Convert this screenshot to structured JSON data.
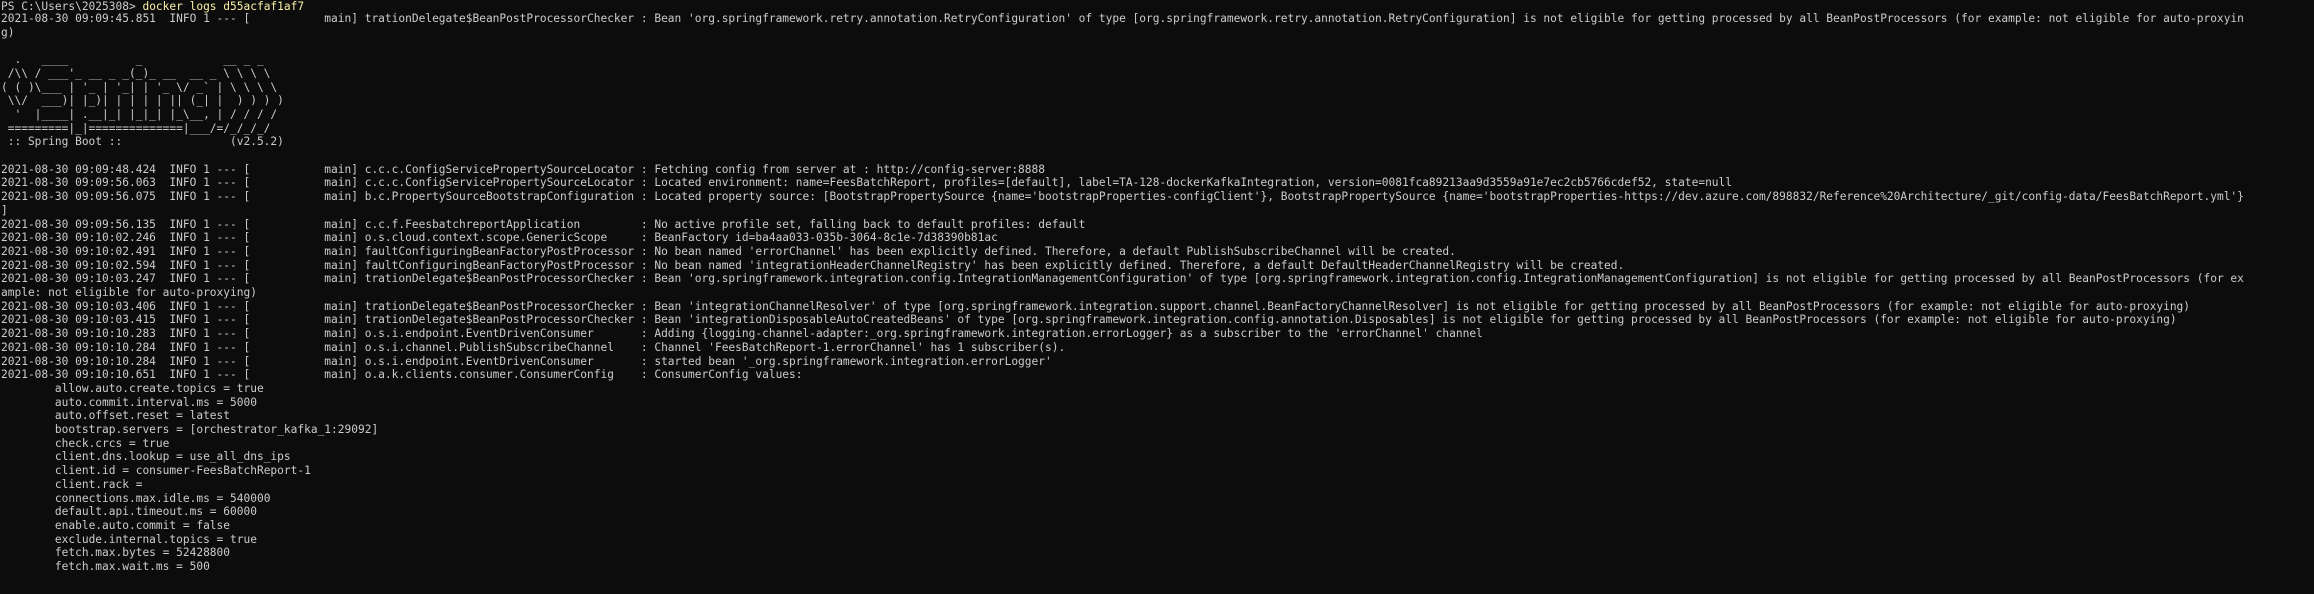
{
  "prompt": {
    "path": "PS C:\\Users\\2025308> ",
    "command": "docker logs d55acfaf1af7"
  },
  "lines": [
    "2021-08-30 09:09:45.851  INFO 1 --- [           main] trationDelegate$BeanPostProcessorChecker : Bean 'org.springframework.retry.annotation.RetryConfiguration' of type [org.springframework.retry.annotation.RetryConfiguration] is not eligible for getting processed by all BeanPostProcessors (for example: not eligible for auto-proxyin",
    "g)",
    "",
    "  .   ____          _            __ _ _",
    " /\\\\ / ___'_ __ _ _(_)_ __  __ _ \\ \\ \\ \\",
    "( ( )\\___ | '_ | '_| | '_ \\/ _` | \\ \\ \\ \\",
    " \\\\/  ___)| |_)| | | | | || (_| |  ) ) ) )",
    "  '  |____| .__|_| |_|_| |_\\__, | / / / /",
    " =========|_|==============|___/=/_/_/_/",
    " :: Spring Boot ::                (v2.5.2)",
    "",
    "2021-08-30 09:09:48.424  INFO 1 --- [           main] c.c.c.ConfigServicePropertySourceLocator : Fetching config from server at : http://config-server:8888",
    "2021-08-30 09:09:56.063  INFO 1 --- [           main] c.c.c.ConfigServicePropertySourceLocator : Located environment: name=FeesBatchReport, profiles=[default], label=TA-128-dockerKafkaIntegration, version=0081fca89213aa9d3559a91e7ec2cb5766cdef52, state=null",
    "2021-08-30 09:09:56.075  INFO 1 --- [           main] b.c.PropertySourceBootstrapConfiguration : Located property source: [BootstrapPropertySource {name='bootstrapProperties-configClient'}, BootstrapPropertySource {name='bootstrapProperties-https://dev.azure.com/898832/Reference%20Architecture/_git/config-data/FeesBatchReport.yml'}",
    "]",
    "2021-08-30 09:09:56.135  INFO 1 --- [           main] c.c.f.FeesbatchreportApplication         : No active profile set, falling back to default profiles: default",
    "2021-08-30 09:10:02.246  INFO 1 --- [           main] o.s.cloud.context.scope.GenericScope     : BeanFactory id=ba4aa033-035b-3064-8c1e-7d38390b81ac",
    "2021-08-30 09:10:02.491  INFO 1 --- [           main] faultConfiguringBeanFactoryPostProcessor : No bean named 'errorChannel' has been explicitly defined. Therefore, a default PublishSubscribeChannel will be created.",
    "2021-08-30 09:10:02.594  INFO 1 --- [           main] faultConfiguringBeanFactoryPostProcessor : No bean named 'integrationHeaderChannelRegistry' has been explicitly defined. Therefore, a default DefaultHeaderChannelRegistry will be created.",
    "2021-08-30 09:10:03.247  INFO 1 --- [           main] trationDelegate$BeanPostProcessorChecker : Bean 'org.springframework.integration.config.IntegrationManagementConfiguration' of type [org.springframework.integration.config.IntegrationManagementConfiguration] is not eligible for getting processed by all BeanPostProcessors (for ex",
    "ample: not eligible for auto-proxying)",
    "2021-08-30 09:10:03.406  INFO 1 --- [           main] trationDelegate$BeanPostProcessorChecker : Bean 'integrationChannelResolver' of type [org.springframework.integration.support.channel.BeanFactoryChannelResolver] is not eligible for getting processed by all BeanPostProcessors (for example: not eligible for auto-proxying)",
    "2021-08-30 09:10:03.415  INFO 1 --- [           main] trationDelegate$BeanPostProcessorChecker : Bean 'integrationDisposableAutoCreatedBeans' of type [org.springframework.integration.config.annotation.Disposables] is not eligible for getting processed by all BeanPostProcessors (for example: not eligible for auto-proxying)",
    "2021-08-30 09:10:10.283  INFO 1 --- [           main] o.s.i.endpoint.EventDrivenConsumer       : Adding {logging-channel-adapter:_org.springframework.integration.errorLogger} as a subscriber to the 'errorChannel' channel",
    "2021-08-30 09:10:10.284  INFO 1 --- [           main] o.s.i.channel.PublishSubscribeChannel    : Channel 'FeesBatchReport-1.errorChannel' has 1 subscriber(s).",
    "2021-08-30 09:10:10.284  INFO 1 --- [           main] o.s.i.endpoint.EventDrivenConsumer       : started bean '_org.springframework.integration.errorLogger'",
    "2021-08-30 09:10:10.651  INFO 1 --- [           main] o.a.k.clients.consumer.ConsumerConfig    : ConsumerConfig values: ",
    "\tallow.auto.create.topics = true",
    "\tauto.commit.interval.ms = 5000",
    "\tauto.offset.reset = latest",
    "\tbootstrap.servers = [orchestrator_kafka_1:29092]",
    "\tcheck.crcs = true",
    "\tclient.dns.lookup = use_all_dns_ips",
    "\tclient.id = consumer-FeesBatchReport-1",
    "\tclient.rack = ",
    "\tconnections.max.idle.ms = 540000",
    "\tdefault.api.timeout.ms = 60000",
    "\tenable.auto.commit = false",
    "\texclude.internal.topics = true",
    "\tfetch.max.bytes = 52428800",
    "\tfetch.max.wait.ms = 500"
  ]
}
